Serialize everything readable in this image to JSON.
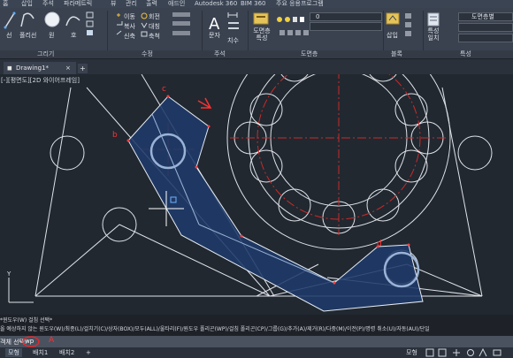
{
  "menu_tabs": [
    "홈",
    "삽입",
    "주석",
    "파라메트릭",
    "뷰",
    "관리",
    "출력",
    "애드인",
    "Autodesk 360",
    "BIM 360",
    "주요 응용프로그램"
  ],
  "ribbon": {
    "draw": {
      "line": "선",
      "polyline": "폴리선",
      "circle": "원",
      "arc": "호"
    },
    "modify": {
      "move": "이동",
      "rotate": "회전",
      "copy": "복사",
      "mirror": "대칭",
      "stretch": "신축",
      "scale": "축척"
    },
    "annotation": {
      "text": "문자",
      "dimension": "치수"
    },
    "layers": {
      "props": "도면층 특성",
      "layer_value": "0"
    },
    "block": {
      "insert": "삽입"
    },
    "properties": {
      "match": "특성 일치",
      "bylayer": "도면층별"
    }
  },
  "panels": [
    "그리기",
    "수정",
    "주석",
    "도면층",
    "블록",
    "특성"
  ],
  "document": {
    "tab": "Drawing1*",
    "plus": "+"
  },
  "viewport_label": "[-][평면도][2D 와이어프레임]",
  "annotations": {
    "b": "b",
    "c": "c",
    "d": "d"
  },
  "command": {
    "history1": "*윈도우(W) 걸침 선택*",
    "history2": "올 예상하지 않는 원도우(W)/최종(L)/걸치기(C)/상자(BOX)/모두(ALL)/울타리(F)/원도우 폴리곤(WP)/걸침 폴리곤(CP)/그룹(G)/추가(A)/제거(R)/다중(M)/이전(P)/명령 취소(U)/자동(AU)/단일",
    "label": "객체 선택:",
    "input": "wp",
    "mark": "A"
  },
  "status": {
    "model": "모형",
    "layout1": "배치1",
    "layout2": "배치2",
    "plus": "+",
    "model_right": "모형"
  }
}
